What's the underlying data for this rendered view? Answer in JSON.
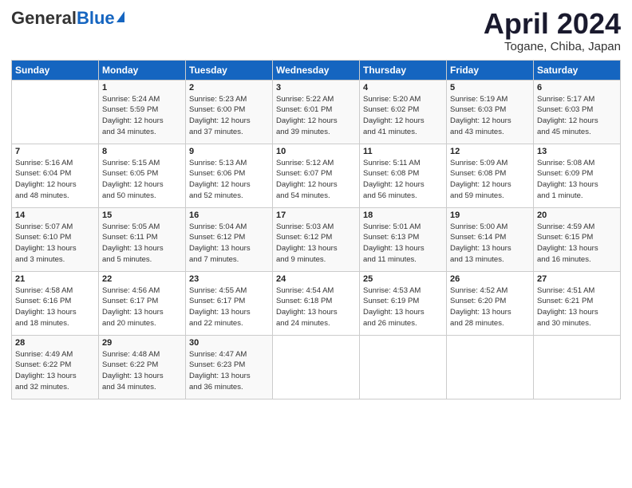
{
  "header": {
    "logo_general": "General",
    "logo_blue": "Blue",
    "month_title": "April 2024",
    "location": "Togane, Chiba, Japan"
  },
  "days_of_week": [
    "Sunday",
    "Monday",
    "Tuesday",
    "Wednesday",
    "Thursday",
    "Friday",
    "Saturday"
  ],
  "weeks": [
    [
      {
        "day": "",
        "info": ""
      },
      {
        "day": "1",
        "info": "Sunrise: 5:24 AM\nSunset: 5:59 PM\nDaylight: 12 hours\nand 34 minutes."
      },
      {
        "day": "2",
        "info": "Sunrise: 5:23 AM\nSunset: 6:00 PM\nDaylight: 12 hours\nand 37 minutes."
      },
      {
        "day": "3",
        "info": "Sunrise: 5:22 AM\nSunset: 6:01 PM\nDaylight: 12 hours\nand 39 minutes."
      },
      {
        "day": "4",
        "info": "Sunrise: 5:20 AM\nSunset: 6:02 PM\nDaylight: 12 hours\nand 41 minutes."
      },
      {
        "day": "5",
        "info": "Sunrise: 5:19 AM\nSunset: 6:03 PM\nDaylight: 12 hours\nand 43 minutes."
      },
      {
        "day": "6",
        "info": "Sunrise: 5:17 AM\nSunset: 6:03 PM\nDaylight: 12 hours\nand 45 minutes."
      }
    ],
    [
      {
        "day": "7",
        "info": "Sunrise: 5:16 AM\nSunset: 6:04 PM\nDaylight: 12 hours\nand 48 minutes."
      },
      {
        "day": "8",
        "info": "Sunrise: 5:15 AM\nSunset: 6:05 PM\nDaylight: 12 hours\nand 50 minutes."
      },
      {
        "day": "9",
        "info": "Sunrise: 5:13 AM\nSunset: 6:06 PM\nDaylight: 12 hours\nand 52 minutes."
      },
      {
        "day": "10",
        "info": "Sunrise: 5:12 AM\nSunset: 6:07 PM\nDaylight: 12 hours\nand 54 minutes."
      },
      {
        "day": "11",
        "info": "Sunrise: 5:11 AM\nSunset: 6:08 PM\nDaylight: 12 hours\nand 56 minutes."
      },
      {
        "day": "12",
        "info": "Sunrise: 5:09 AM\nSunset: 6:08 PM\nDaylight: 12 hours\nand 59 minutes."
      },
      {
        "day": "13",
        "info": "Sunrise: 5:08 AM\nSunset: 6:09 PM\nDaylight: 13 hours\nand 1 minute."
      }
    ],
    [
      {
        "day": "14",
        "info": "Sunrise: 5:07 AM\nSunset: 6:10 PM\nDaylight: 13 hours\nand 3 minutes."
      },
      {
        "day": "15",
        "info": "Sunrise: 5:05 AM\nSunset: 6:11 PM\nDaylight: 13 hours\nand 5 minutes."
      },
      {
        "day": "16",
        "info": "Sunrise: 5:04 AM\nSunset: 6:12 PM\nDaylight: 13 hours\nand 7 minutes."
      },
      {
        "day": "17",
        "info": "Sunrise: 5:03 AM\nSunset: 6:12 PM\nDaylight: 13 hours\nand 9 minutes."
      },
      {
        "day": "18",
        "info": "Sunrise: 5:01 AM\nSunset: 6:13 PM\nDaylight: 13 hours\nand 11 minutes."
      },
      {
        "day": "19",
        "info": "Sunrise: 5:00 AM\nSunset: 6:14 PM\nDaylight: 13 hours\nand 13 minutes."
      },
      {
        "day": "20",
        "info": "Sunrise: 4:59 AM\nSunset: 6:15 PM\nDaylight: 13 hours\nand 16 minutes."
      }
    ],
    [
      {
        "day": "21",
        "info": "Sunrise: 4:58 AM\nSunset: 6:16 PM\nDaylight: 13 hours\nand 18 minutes."
      },
      {
        "day": "22",
        "info": "Sunrise: 4:56 AM\nSunset: 6:17 PM\nDaylight: 13 hours\nand 20 minutes."
      },
      {
        "day": "23",
        "info": "Sunrise: 4:55 AM\nSunset: 6:17 PM\nDaylight: 13 hours\nand 22 minutes."
      },
      {
        "day": "24",
        "info": "Sunrise: 4:54 AM\nSunset: 6:18 PM\nDaylight: 13 hours\nand 24 minutes."
      },
      {
        "day": "25",
        "info": "Sunrise: 4:53 AM\nSunset: 6:19 PM\nDaylight: 13 hours\nand 26 minutes."
      },
      {
        "day": "26",
        "info": "Sunrise: 4:52 AM\nSunset: 6:20 PM\nDaylight: 13 hours\nand 28 minutes."
      },
      {
        "day": "27",
        "info": "Sunrise: 4:51 AM\nSunset: 6:21 PM\nDaylight: 13 hours\nand 30 minutes."
      }
    ],
    [
      {
        "day": "28",
        "info": "Sunrise: 4:49 AM\nSunset: 6:22 PM\nDaylight: 13 hours\nand 32 minutes."
      },
      {
        "day": "29",
        "info": "Sunrise: 4:48 AM\nSunset: 6:22 PM\nDaylight: 13 hours\nand 34 minutes."
      },
      {
        "day": "30",
        "info": "Sunrise: 4:47 AM\nSunset: 6:23 PM\nDaylight: 13 hours\nand 36 minutes."
      },
      {
        "day": "",
        "info": ""
      },
      {
        "day": "",
        "info": ""
      },
      {
        "day": "",
        "info": ""
      },
      {
        "day": "",
        "info": ""
      }
    ]
  ]
}
